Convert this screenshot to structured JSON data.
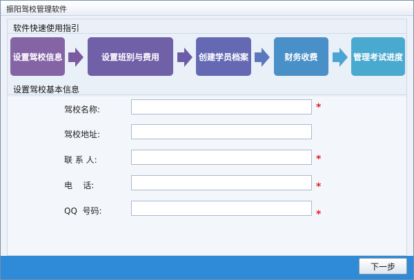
{
  "window": {
    "title": "振阳驾校管理软件"
  },
  "guide": {
    "title": "软件快速使用指引",
    "steps": [
      {
        "label": "设置驾校信息",
        "color": "#8564a6"
      },
      {
        "label": "设置班别与费用",
        "color": "#7060a8"
      },
      {
        "label": "创建学员档案",
        "color": "#6569b4"
      },
      {
        "label": "财务收费",
        "color": "#4a90c8"
      },
      {
        "label": "管理考试进度",
        "color": "#4aa9cf"
      }
    ],
    "arrow_colors": [
      "#7a5aa0",
      "#6c5ca8",
      "#5a78be",
      "#4aa4d4"
    ]
  },
  "basic": {
    "title": "设置驾校基本信息",
    "fields": [
      {
        "label": "驾校名称:",
        "value": "",
        "required": true
      },
      {
        "label": "驾校地址:",
        "value": "",
        "required": false
      },
      {
        "label": "联 系 人:",
        "value": "",
        "required": true
      },
      {
        "label": "电    话:",
        "value": "",
        "required": true
      },
      {
        "label": "QQ  号码:",
        "value": "",
        "required": true
      }
    ],
    "required_mark": "*"
  },
  "footer": {
    "next_label": "下一步"
  }
}
